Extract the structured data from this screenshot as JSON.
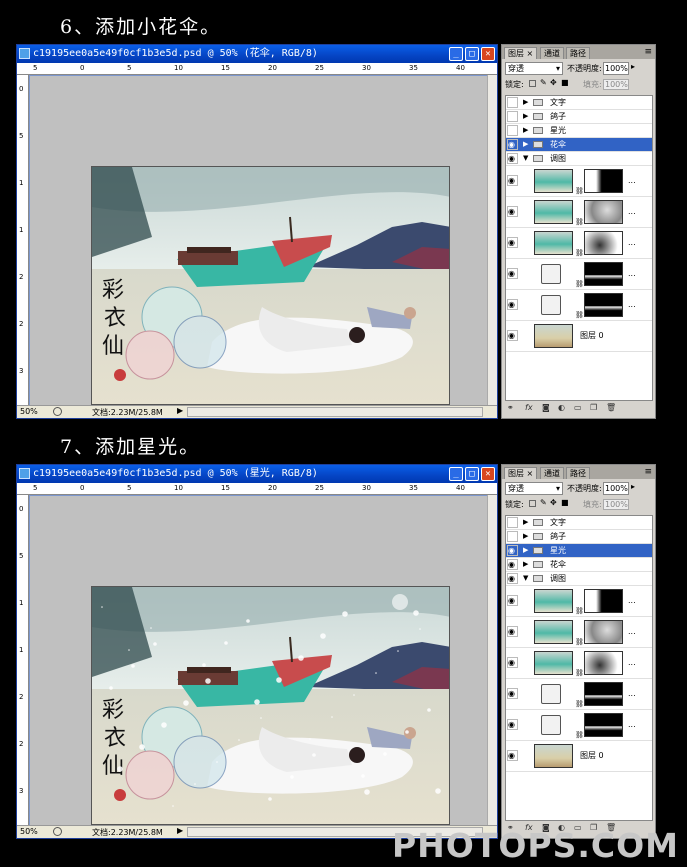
{
  "steps": [
    {
      "heading": "6、添加小花伞。",
      "doc_title": "c19195ee0a5e49f0cf1b3e5d.psd @ 50% (花伞, RGB/8)",
      "ruler_h": [
        "5",
        "0",
        "5",
        "10",
        "15",
        "20",
        "25",
        "30",
        "35",
        "40"
      ],
      "ruler_v": [
        "0",
        "5",
        "1",
        "1",
        "2",
        "2",
        "3"
      ],
      "zoom": "50%",
      "doc_size": "文档:2.23M/25.8M",
      "panel": {
        "tabs": [
          "图层",
          "通道",
          "路径"
        ],
        "blend": "穿透",
        "opacity_label": "不透明度:",
        "opacity": "100%",
        "lock_label": "锁定:",
        "fill_label": "填充:",
        "fill": "100%",
        "layers": [
          {
            "name": "文字",
            "kind": "group",
            "visible": false,
            "selected": false,
            "open": false
          },
          {
            "name": "鸽子",
            "kind": "group",
            "visible": false,
            "selected": false,
            "open": false
          },
          {
            "name": "星光",
            "kind": "group",
            "visible": false,
            "selected": false,
            "open": false
          },
          {
            "name": "花伞",
            "kind": "group",
            "visible": true,
            "selected": true,
            "open": false
          },
          {
            "name": "调图",
            "kind": "group",
            "visible": true,
            "selected": false,
            "open": true
          },
          {
            "name": "",
            "kind": "adj-photo",
            "visible": true
          },
          {
            "name": "",
            "kind": "adj-photo",
            "visible": true
          },
          {
            "name": "",
            "kind": "adj-photo",
            "visible": true
          },
          {
            "name": "",
            "kind": "adj-curve",
            "visible": true
          },
          {
            "name": "",
            "kind": "adj-curve",
            "visible": true
          },
          {
            "name": "图层 0",
            "kind": "layer",
            "visible": true
          }
        ]
      }
    },
    {
      "heading": "7、添加星光。",
      "doc_title": "c19195ee0a5e49f0cf1b3e5d.psd @ 50% (星光, RGB/8)",
      "ruler_h": [
        "5",
        "0",
        "5",
        "10",
        "15",
        "20",
        "25",
        "30",
        "35",
        "40"
      ],
      "ruler_v": [
        "0",
        "5",
        "1",
        "1",
        "2",
        "2",
        "3"
      ],
      "zoom": "50%",
      "doc_size": "文档:2.23M/25.8M",
      "panel": {
        "tabs": [
          "图层",
          "通道",
          "路径"
        ],
        "blend": "穿透",
        "opacity_label": "不透明度:",
        "opacity": "100%",
        "lock_label": "锁定:",
        "fill_label": "填充:",
        "fill": "100%",
        "layers": [
          {
            "name": "文字",
            "kind": "group",
            "visible": false,
            "selected": false,
            "open": false
          },
          {
            "name": "鸽子",
            "kind": "group",
            "visible": false,
            "selected": false,
            "open": false
          },
          {
            "name": "星光",
            "kind": "group",
            "visible": true,
            "selected": true,
            "open": false
          },
          {
            "name": "花伞",
            "kind": "group",
            "visible": true,
            "selected": false,
            "open": false
          },
          {
            "name": "调图",
            "kind": "group",
            "visible": true,
            "selected": false,
            "open": true
          },
          {
            "name": "",
            "kind": "adj-photo",
            "visible": true
          },
          {
            "name": "",
            "kind": "adj-photo",
            "visible": true
          },
          {
            "name": "",
            "kind": "adj-photo",
            "visible": true
          },
          {
            "name": "",
            "kind": "adj-curve",
            "visible": true
          },
          {
            "name": "",
            "kind": "adj-curve",
            "visible": true
          },
          {
            "name": "图层 0",
            "kind": "layer",
            "visible": true
          }
        ]
      }
    }
  ],
  "watermark": "PHOTOPS.COM"
}
